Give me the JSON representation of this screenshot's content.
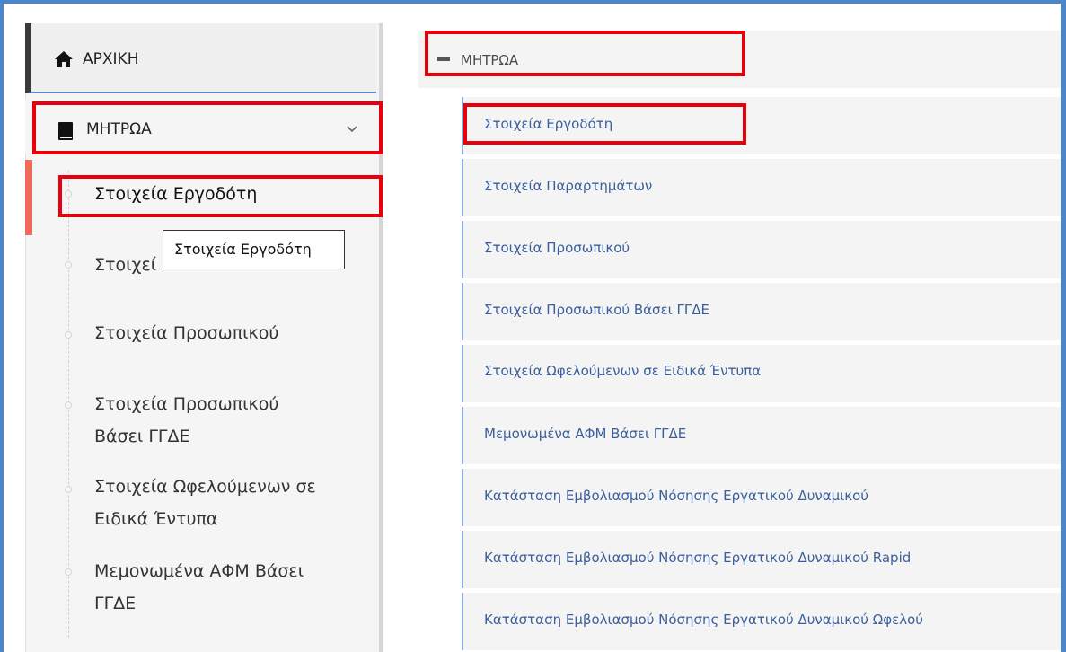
{
  "sidebar": {
    "home_label": "ΑΡΧΙΚΗ",
    "registry_label": "ΜΗΤΡΩΑ",
    "sub_items": [
      "Στοιχεία Εργοδότη",
      "Στοιχεί",
      "Στοιχεία Προσωπικού",
      "Στοιχεία Προσωπικού",
      "Βάσει ΓΓΔΕ",
      "Στοιχεία Ωφελούμενων σε",
      "Ειδικά Έντυπα",
      "Μεμονωμένα ΑΦΜ Βάσει",
      "ΓΓΔΕ"
    ],
    "tooltip": "Στοιχεία Εργοδότη"
  },
  "right": {
    "header_label": "ΜΗΤΡΩΑ",
    "items": [
      "Στοιχεία Εργοδότη",
      "Στοιχεία Παραρτημάτων",
      "Στοιχεία Προσωπικού",
      "Στοιχεία Προσωπικού Βάσει ΓΓΔΕ",
      "Στοιχεία Ωφελούμενων σε Ειδικά Έντυπα",
      "Μεμονωμένα ΑΦΜ Βάσει ΓΓΔΕ",
      "Κατάσταση Εμβολιασμού Νόσησης Εργατικού Δυναμικού",
      "Κατάσταση Εμβολιασμού Νόσησης Εργατικού Δυναμικού Rapid",
      "Κατάσταση Εμβολιασμού Νόσησης Εργατικού Δυναμικού Ωφελού"
    ]
  },
  "colors": {
    "highlight": "#e8000c",
    "frame": "#4a86c8",
    "active_bar": "#ef6a5b",
    "link": "#3b5f9c"
  }
}
